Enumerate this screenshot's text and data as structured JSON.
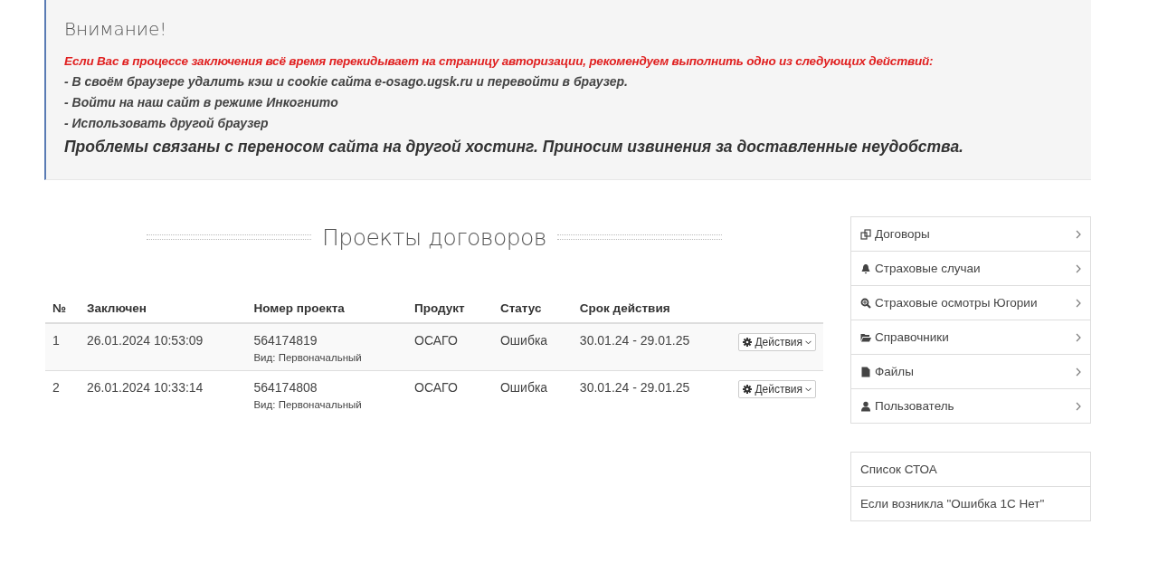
{
  "notice": {
    "title": "Внимание!",
    "warning": "Если Вас в процессе заключения всё время перекидывает на страницу авторизации, рекомендуем выполнить одно из следующих действий:",
    "steps": [
      "- В своём браузере удалить кэш и cookie сайта e-osago.ugsk.ru и перевойти в браузер.",
      "- Войти на наш сайт в режиме Инкогнито",
      "- Использовать другой браузер"
    ],
    "apology": "Проблемы связаны с переносом сайта на другой хостинг. Приносим извинения за доставленные неудобства."
  },
  "heading": "Проекты договоров",
  "table": {
    "columns": [
      "№",
      "Заключен",
      "Номер проекта",
      "Продукт",
      "Статус",
      "Срок действия"
    ],
    "rows": [
      {
        "no": "1",
        "date": "26.01.2024 10:53:09",
        "number": "564174819",
        "type": "Вид: Первоначальный",
        "product": "ОСАГО",
        "status": "Ошибка",
        "period": "30.01.24 - 29.01.25",
        "action": "Действия"
      },
      {
        "no": "2",
        "date": "26.01.2024 10:33:14",
        "number": "564174808",
        "type": "Вид: Первоначальный",
        "product": "ОСАГО",
        "status": "Ошибка",
        "period": "30.01.24 - 29.01.25",
        "action": "Действия"
      }
    ]
  },
  "sidebar": {
    "items": [
      "Договоры",
      "Страховые случаи",
      "Страховые осмотры Югории",
      "Справочники",
      "Файлы",
      "Пользователь"
    ]
  },
  "links": [
    "Список СТОА",
    "Если возникла \"Ошибка 1С Нет\""
  ]
}
